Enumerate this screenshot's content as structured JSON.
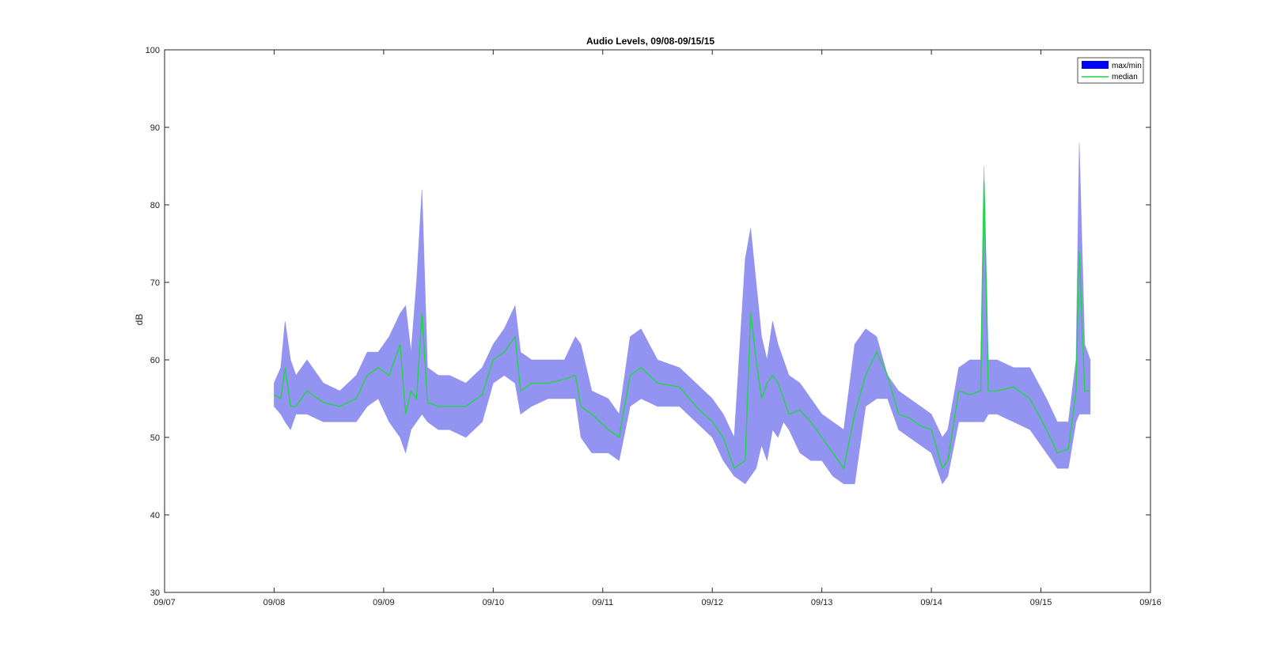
{
  "chart_data": {
    "type": "area",
    "title": "Audio Levels, 09/08-09/15/15",
    "xlabel": "",
    "ylabel": "dB",
    "x_unit": "day of September 2015",
    "xlim": [
      7,
      16
    ],
    "ylim": [
      30,
      100
    ],
    "x_ticks": [
      "09/07",
      "09/08",
      "09/09",
      "09/10",
      "09/11",
      "09/12",
      "09/13",
      "09/14",
      "09/15",
      "09/16"
    ],
    "y_ticks": [
      30,
      40,
      50,
      60,
      70,
      80,
      90,
      100
    ],
    "grid": false,
    "legend_position": "top-right",
    "colors": {
      "band": "#0000ff",
      "band_fill": "#8080ee",
      "median": "#1fd645",
      "axis": "#262626"
    },
    "series": [
      {
        "name": "max/min",
        "x": [
          8.0,
          8.06,
          8.1,
          8.15,
          8.2,
          8.3,
          8.45,
          8.6,
          8.75,
          8.85,
          8.95,
          9.05,
          9.15,
          9.2,
          9.25,
          9.3,
          9.35,
          9.4,
          9.5,
          9.6,
          9.75,
          9.9,
          10.0,
          10.1,
          10.2,
          10.25,
          10.35,
          10.5,
          10.65,
          10.75,
          10.8,
          10.9,
          11.05,
          11.15,
          11.25,
          11.35,
          11.5,
          11.7,
          11.85,
          12.0,
          12.1,
          12.2,
          12.3,
          12.35,
          12.4,
          12.45,
          12.5,
          12.55,
          12.6,
          12.65,
          12.7,
          12.8,
          12.9,
          13.0,
          13.1,
          13.2,
          13.3,
          13.4,
          13.5,
          13.6,
          13.7,
          13.8,
          13.9,
          14.0,
          14.1,
          14.15,
          14.25,
          14.35,
          14.45,
          14.48,
          14.52,
          14.6,
          14.75,
          14.9,
          15.05,
          15.15,
          15.25,
          15.32,
          15.35,
          15.4,
          15.45
        ],
        "max": [
          57,
          59,
          65,
          60,
          58,
          60,
          57,
          56,
          58,
          61,
          61,
          63,
          66,
          67,
          61,
          70,
          82,
          59,
          58,
          58,
          57,
          59,
          62,
          64,
          67,
          61,
          60,
          60,
          60,
          63,
          62,
          56,
          55,
          53,
          63,
          64,
          60,
          59,
          57,
          55,
          53,
          50,
          73,
          77,
          70,
          63,
          60,
          65,
          62,
          60,
          58,
          57,
          55,
          53,
          52,
          51,
          62,
          64,
          63,
          58,
          56,
          55,
          54,
          53,
          50,
          51,
          59,
          60,
          60,
          85,
          60,
          60,
          59,
          59,
          55,
          52,
          52,
          60,
          88,
          62,
          60
        ],
        "min": [
          54,
          53,
          52,
          51,
          53,
          53,
          52,
          52,
          52,
          54,
          55,
          52,
          50,
          48,
          51,
          52,
          53,
          52,
          51,
          51,
          50,
          52,
          57,
          58,
          57,
          53,
          54,
          55,
          55,
          55,
          50,
          48,
          48,
          47,
          54,
          55,
          54,
          54,
          52,
          50,
          47,
          45,
          44,
          45,
          46,
          49,
          47,
          51,
          50,
          52,
          51,
          48,
          47,
          47,
          45,
          44,
          44,
          54,
          55,
          55,
          51,
          50,
          49,
          48,
          44,
          45,
          52,
          52,
          52,
          52,
          53,
          53,
          52,
          51,
          48,
          46,
          46,
          52,
          53,
          53,
          53
        ]
      },
      {
        "name": "median",
        "x": [
          8.0,
          8.06,
          8.1,
          8.15,
          8.2,
          8.3,
          8.45,
          8.6,
          8.75,
          8.85,
          8.95,
          9.05,
          9.15,
          9.2,
          9.25,
          9.3,
          9.35,
          9.4,
          9.5,
          9.6,
          9.75,
          9.9,
          10.0,
          10.1,
          10.2,
          10.25,
          10.35,
          10.5,
          10.65,
          10.75,
          10.8,
          10.9,
          11.05,
          11.15,
          11.25,
          11.35,
          11.5,
          11.7,
          11.85,
          12.0,
          12.1,
          12.2,
          12.3,
          12.35,
          12.4,
          12.45,
          12.5,
          12.55,
          12.6,
          12.65,
          12.7,
          12.8,
          12.9,
          13.0,
          13.1,
          13.2,
          13.3,
          13.4,
          13.5,
          13.6,
          13.7,
          13.8,
          13.9,
          14.0,
          14.1,
          14.15,
          14.25,
          14.35,
          14.45,
          14.48,
          14.52,
          14.6,
          14.75,
          14.9,
          15.05,
          15.15,
          15.25,
          15.32,
          15.35,
          15.4,
          15.45
        ],
        "values": [
          55.5,
          55,
          59,
          54,
          54,
          56,
          54.5,
          54,
          55,
          58,
          59,
          58,
          62,
          53,
          56,
          55,
          66,
          54.5,
          54,
          54,
          54,
          55.5,
          60,
          61,
          63,
          56,
          57,
          57,
          57.5,
          58,
          54,
          53,
          51,
          50,
          58,
          59,
          57,
          56.5,
          54,
          52,
          50,
          46,
          47,
          66,
          60,
          55,
          57,
          58,
          57,
          55,
          53,
          53.5,
          52,
          50,
          48,
          46,
          53,
          58,
          61,
          58,
          53,
          52.5,
          51.5,
          51,
          46,
          47,
          56,
          55.5,
          56,
          83,
          56,
          56,
          56.5,
          55,
          51,
          48,
          48.5,
          56,
          74,
          56,
          56
        ]
      }
    ]
  }
}
